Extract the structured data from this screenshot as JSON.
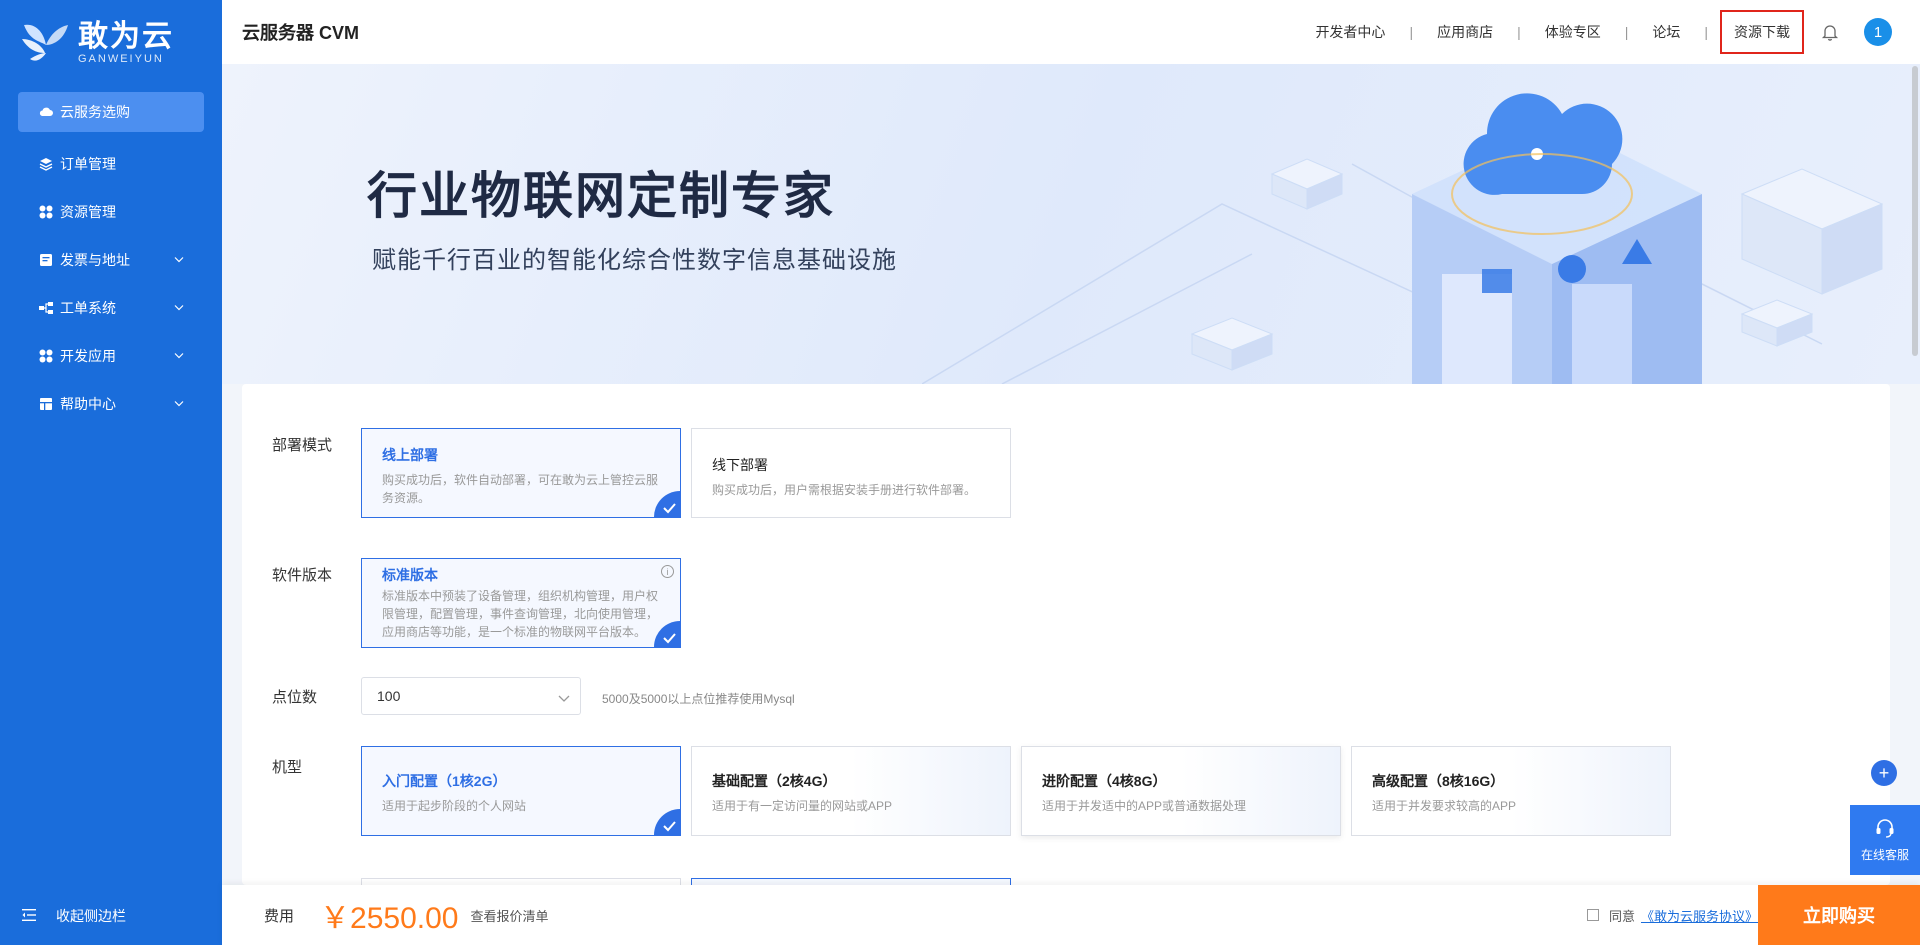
{
  "brand": {
    "name_cn": "敢为云",
    "name_en": "GANWEIYUN"
  },
  "sidebar": {
    "items": [
      {
        "label": "云服务选购",
        "icon": "cloud-icon",
        "active": true
      },
      {
        "label": "订单管理",
        "icon": "layers-icon"
      },
      {
        "label": "资源管理",
        "icon": "grid-icon"
      },
      {
        "label": "发票与地址",
        "icon": "invoice-icon",
        "expandable": true
      },
      {
        "label": "工单系统",
        "icon": "tree-icon",
        "expandable": true
      },
      {
        "label": "开发应用",
        "icon": "apps-icon",
        "expandable": true
      },
      {
        "label": "帮助中心",
        "icon": "book-icon",
        "expandable": true
      }
    ],
    "collapse_label": "收起侧边栏"
  },
  "header": {
    "title": "云服务器 CVM",
    "nav": [
      "开发者中心",
      "应用商店",
      "体验专区",
      "论坛",
      "资源下载"
    ],
    "separator": "|",
    "avatar_text": "1"
  },
  "banner": {
    "title": "行业物联网定制专家",
    "subtitle": "赋能千行百业的智能化综合性数字信息基础设施"
  },
  "form": {
    "deploy_mode": {
      "label": "部署模式",
      "options": [
        {
          "title": "线上部署",
          "desc": "购买成功后，软件自动部署，可在敢为云上管控云服务资源。",
          "selected": true
        },
        {
          "title": "线下部署",
          "desc": "购买成功后，用户需根据安装手册进行软件部署。",
          "selected": false
        }
      ]
    },
    "software_version": {
      "label": "软件版本",
      "option": {
        "title": "标准版本",
        "desc": "标准版本中预装了设备管理，组织机构管理，用户权限管理，配置管理，事件查询管理，北向使用管理，应用商店等功能，是一个标准的物联网平台版本。",
        "selected": true
      }
    },
    "points": {
      "label": "点位数",
      "value": "100",
      "hint": "5000及5000以上点位推荐使用Mysql"
    },
    "machine": {
      "label": "机型",
      "options": [
        {
          "title": "入门配置（1核2G）",
          "desc": "适用于起步阶段的个人网站",
          "selected": true
        },
        {
          "title": "基础配置（2核4G）",
          "desc": "适用于有一定访问量的网站或APP",
          "selected": false
        },
        {
          "title": "进阶配置（4核8G）",
          "desc": "适用于并发适中的APP或普通数据处理",
          "selected": false
        },
        {
          "title": "高级配置（8核16G）",
          "desc": "适用于并发要求较高的APP",
          "selected": false
        }
      ]
    }
  },
  "footer": {
    "fee_label": "费用",
    "price": "￥2550.00",
    "quote_link": "查看报价清单",
    "agree_prefix": "同意",
    "agree_link": "《敢为云服务协议》",
    "buy_label": "立即购买"
  },
  "floats": {
    "plus": "+",
    "service_label": "在线客服"
  },
  "colors": {
    "sidebar": "#1a6ddb",
    "accent": "#2f6fe4",
    "price": "#ff7a1a",
    "highlight_border": "#e0251b"
  }
}
